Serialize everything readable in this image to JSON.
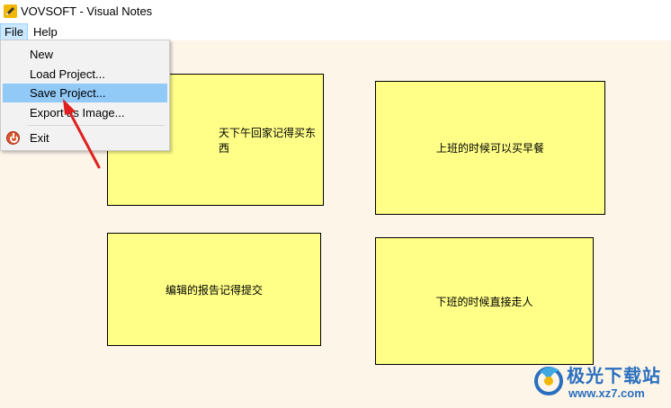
{
  "window": {
    "title": "VOVSOFT - Visual Notes"
  },
  "menubar": {
    "file": "File",
    "help": "Help"
  },
  "file_menu": {
    "items": [
      "New",
      "Load Project...",
      "Save Project...",
      "Export as Image...",
      "Exit"
    ],
    "highlighted": "Save Project..."
  },
  "notes": [
    {
      "text": "天下午回家记得买东西"
    },
    {
      "text": "上班的时候可以买早餐"
    },
    {
      "text": "编辑的报告记得提交"
    },
    {
      "text": "下班的时候直接走人"
    }
  ],
  "colors": {
    "note_fill": "#ffff88",
    "canvas_bg": "#fdf5e8",
    "menu_highlight": "#91c9f7",
    "annotation_arrow": "#e02020"
  },
  "watermark": {
    "title": "极光下载站",
    "url": "www.xz7.com"
  }
}
